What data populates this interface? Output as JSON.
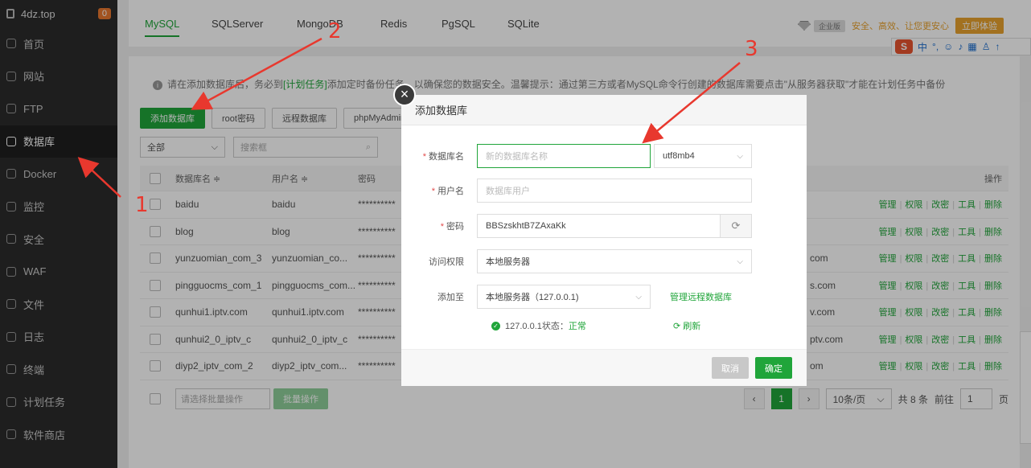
{
  "sidebar": {
    "site": "4dz.top",
    "badge": "0",
    "items": [
      {
        "label": "首页",
        "name": "home"
      },
      {
        "label": "网站",
        "name": "website"
      },
      {
        "label": "FTP",
        "name": "ftp"
      },
      {
        "label": "数据库",
        "name": "database",
        "active": true
      },
      {
        "label": "Docker",
        "name": "docker"
      },
      {
        "label": "监控",
        "name": "monitor"
      },
      {
        "label": "安全",
        "name": "security"
      },
      {
        "label": "WAF",
        "name": "waf"
      },
      {
        "label": "文件",
        "name": "files"
      },
      {
        "label": "日志",
        "name": "logs"
      },
      {
        "label": "终端",
        "name": "terminal"
      },
      {
        "label": "计划任务",
        "name": "cron"
      },
      {
        "label": "软件商店",
        "name": "store"
      }
    ]
  },
  "tabs": [
    {
      "label": "MySQL",
      "active": true
    },
    {
      "label": "SQLServer"
    },
    {
      "label": "MongoDB"
    },
    {
      "label": "Redis"
    },
    {
      "label": "PgSQL"
    },
    {
      "label": "SQLite"
    }
  ],
  "promo": {
    "edition": "企业版",
    "slogan": "安全、高效、让您更安心",
    "button": "立即体验"
  },
  "ime": {
    "logo": "S",
    "lang": "中"
  },
  "tip": {
    "before": "请在添加数据库后，务必到",
    "link": "[计划任务]",
    "after": "添加定时备份任务，以确保您的数据安全。温馨提示：通过第三方或者MySQL命令行创建的数据库需要点击\"从服务器获取\"才能在计划任务中备份"
  },
  "toolbar": {
    "add_db": "添加数据库",
    "root_pwd": "root密码",
    "remote_db": "远程数据库",
    "phpmyadmin": "phpMyAdmin"
  },
  "filter": {
    "all": "全部",
    "search_placeholder": "搜索框"
  },
  "table": {
    "headers": {
      "name": "数据库名 ≑",
      "user": "用户名 ≑",
      "password": "密码",
      "ops": "操作"
    },
    "ops": [
      "管理",
      "权限",
      "改密",
      "工具",
      "删除"
    ],
    "rows": [
      {
        "name": "baidu",
        "user": "baidu",
        "password": "**********",
        "site": ""
      },
      {
        "name": "blog",
        "user": "blog",
        "password": "**********",
        "site": ""
      },
      {
        "name": "yunzuomian_com_3",
        "user": "yunzuomian_co...",
        "password": "**********",
        "site": "com"
      },
      {
        "name": "pingguocms_com_1",
        "user": "pingguocms_com...",
        "password": "**********",
        "site": "s.com"
      },
      {
        "name": "qunhui1.iptv.com",
        "user": "qunhui1.iptv.com",
        "password": "**********",
        "site": "v.com"
      },
      {
        "name": "qunhui2_0_iptv_c",
        "user": "qunhui2_0_iptv_c",
        "password": "**********",
        "site": "ptv.com"
      },
      {
        "name": "diyp2_iptv_com_2",
        "user": "diyp2_iptv_com...",
        "password": "**********",
        "site": "om"
      }
    ]
  },
  "footer": {
    "batch_placeholder": "请选择批量操作",
    "batch_btn": "批量操作",
    "current_page": "1",
    "per_page": "10条/页",
    "total": "共 8 条",
    "goto": "前往",
    "goto_value": "1",
    "page_suffix": "页"
  },
  "modal": {
    "title": "添加数据库",
    "fields": {
      "db_name_label": "数据库名",
      "db_name_placeholder": "新的数据库名称",
      "charset": "utf8mb4",
      "user_label": "用户名",
      "user_placeholder": "数据库用户",
      "pwd_label": "密码",
      "pwd_value": "BBSzskhtB7ZAxaKk",
      "access_label": "访问权限",
      "access_value": "本地服务器",
      "add_to_label": "添加至",
      "add_to_value": "本地服务器（127.0.0.1)",
      "manage_remote": "管理远程数据库"
    },
    "status_host": "127.0.0.1状态：",
    "status_value": "正常",
    "refresh": "刷新",
    "cancel": "取消",
    "confirm": "确定"
  },
  "annotations": {
    "n1": "1",
    "n2": "2",
    "n3": "3",
    "color": "#e8382e"
  }
}
